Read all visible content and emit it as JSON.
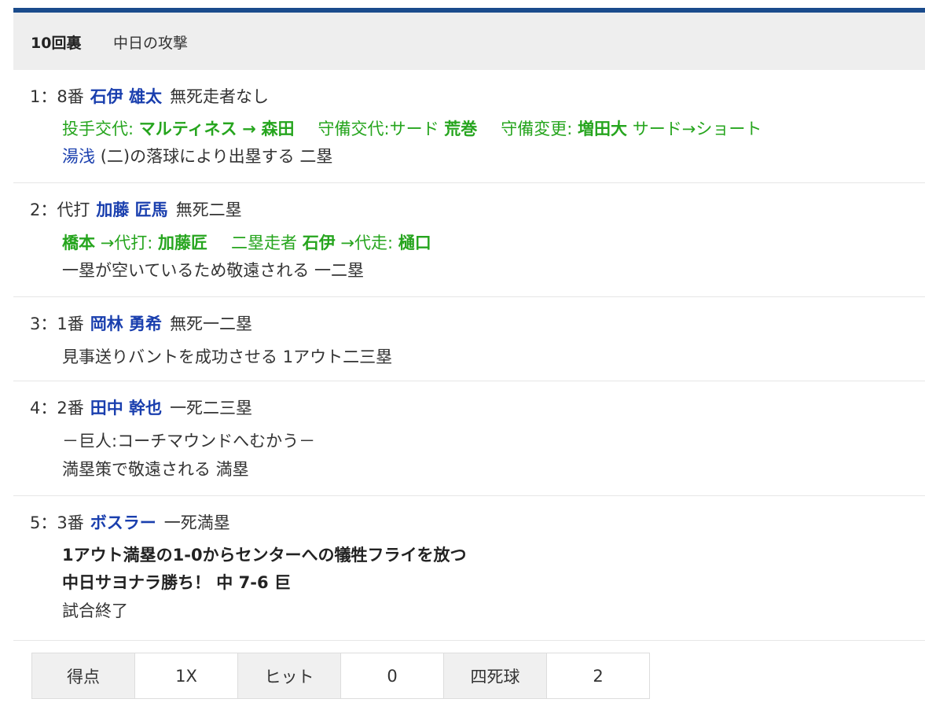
{
  "header": {
    "inning": "10回裏",
    "team_attack": "中日の攻撃"
  },
  "plays": [
    {
      "index": "1：",
      "order": "8番",
      "batter": "石伊 雄太",
      "runners": "無死走者なし",
      "change": {
        "pitch_label": "投手交代:",
        "pitch_out": "マルティネス",
        "arrow": "→",
        "pitch_in": "森田",
        "def_label": "守備交代:サード",
        "def_player": "荒巻",
        "pos_label": "守備変更:",
        "pos_player": "増田大",
        "pos_move": "サード→ショート"
      },
      "result_player": "湯浅",
      "result_text": "(二)の落球により出塁する 二塁"
    },
    {
      "index": "2：",
      "order": "代打",
      "batter": "加藤 匠馬",
      "runners": "無死二塁",
      "change": {
        "out_player": "橋本",
        "ph_label": "→代打:",
        "ph_player": "加藤匠",
        "runner_label": "二塁走者",
        "runner_player": "石伊",
        "pr_label": "→代走:",
        "pr_player": "樋口"
      },
      "result_text": "一塁が空いているため敬遠される 一二塁"
    },
    {
      "index": "3：",
      "order": "1番",
      "batter": "岡林 勇希",
      "runners": "無死一二塁",
      "result_text": "見事送りバントを成功させる 1アウト二三塁"
    },
    {
      "index": "4：",
      "order": "2番",
      "batter": "田中 幹也",
      "runners": "一死二三塁",
      "note": "－巨人:コーチマウンドへむかう－",
      "result_text": "満塁策で敬遠される 満塁"
    },
    {
      "index": "5：",
      "order": "3番",
      "batter": "ボスラー",
      "runners": "一死満塁",
      "result_bold_1": "1アウト満塁の1-0からセンターへの犠牲フライを放つ",
      "result_bold_2": "中日サヨナラ勝ち！ 中 7-6 巨",
      "result_text": "試合終了"
    }
  ],
  "stats": [
    {
      "label": "得点",
      "value": "1X"
    },
    {
      "label": "ヒット",
      "value": "0"
    },
    {
      "label": "四死球",
      "value": "2"
    }
  ],
  "colors": {
    "accent_bar": "#1a4b8c",
    "player_blue": "#1a3fae",
    "change_green": "#26a51e"
  }
}
